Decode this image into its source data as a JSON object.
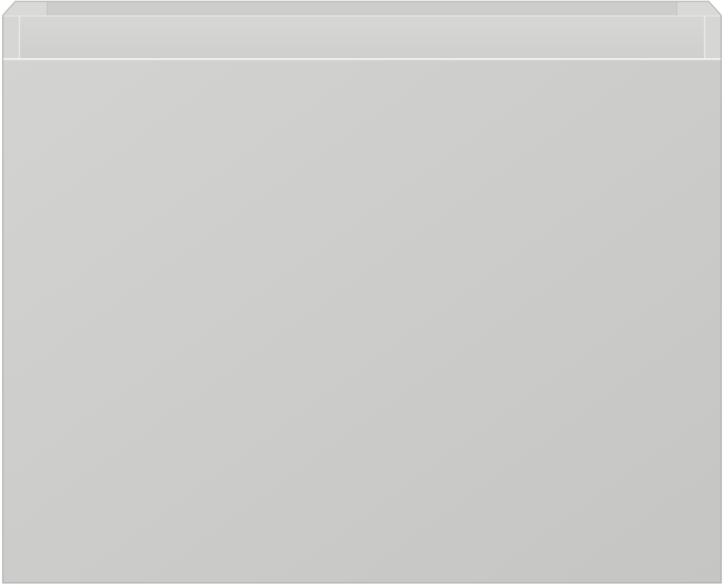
{
  "image": {
    "subject": "cabinet",
    "colors": {
      "body_light": "#d2d2d0",
      "body_dark": "#c6c6c4",
      "rim": "#d4d4d2",
      "rim_inner": "#cfcfcd",
      "rim_top_face": "#dcdcda",
      "inner_back": "#c9c9c7",
      "edge_line": "#ebebe9",
      "outline": "#a8a8a6",
      "background": "#ffffff"
    }
  }
}
